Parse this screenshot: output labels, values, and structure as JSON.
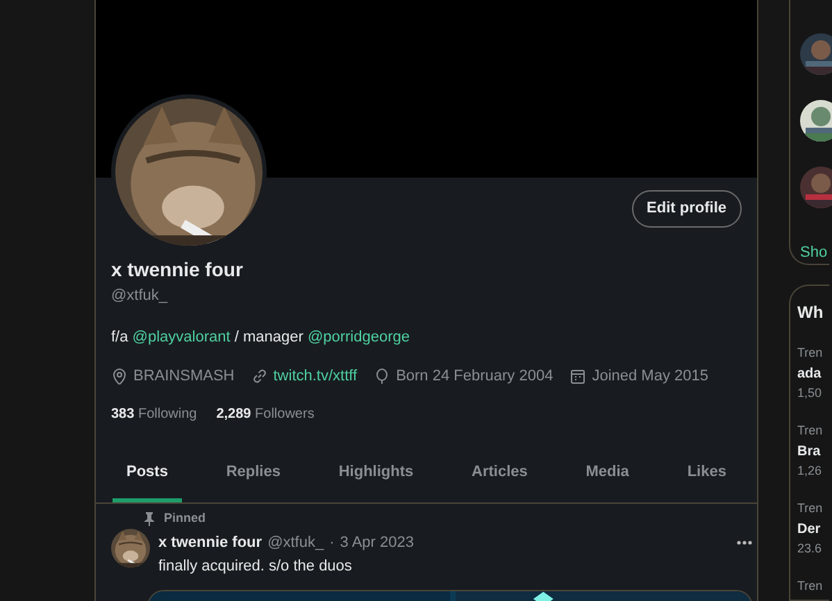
{
  "profile": {
    "edit_button": "Edit profile",
    "name": "x twennie four",
    "handle": "@xtfuk_",
    "bio": [
      {
        "kind": "text",
        "text": "f/a"
      },
      {
        "kind": "link",
        "text": "@playvalorant"
      },
      {
        "kind": "text",
        "text": "/ manager"
      },
      {
        "kind": "link",
        "text": "@porridgeorge"
      }
    ],
    "meta": [
      {
        "kind": "location",
        "text": "BRAINSMASH"
      },
      {
        "kind": "link",
        "text": "twitch.tv/xttff"
      },
      {
        "kind": "birthday",
        "text": "Born 24 February 2004"
      },
      {
        "kind": "joined",
        "text": "Joined May 2015"
      }
    ],
    "stats": [
      {
        "count": "383",
        "label": "Following"
      },
      {
        "count": "2,289",
        "label": "Followers"
      }
    ]
  },
  "tabs": [
    {
      "label": "Posts",
      "selected": true
    },
    {
      "label": "Replies",
      "selected": false
    },
    {
      "label": "Highlights",
      "selected": false
    },
    {
      "label": "Articles",
      "selected": false
    },
    {
      "label": "Media",
      "selected": false
    },
    {
      "label": "Likes",
      "selected": false
    }
  ],
  "pinned_post": {
    "pinned_label": "Pinned",
    "author": "x twennie four",
    "handle": "@xtfuk_",
    "separator": "·",
    "date": "3 Apr 2023",
    "text": "finally acquired. s/o the duos"
  },
  "sidebar": {
    "follow_card": {
      "show_more": "Sho"
    },
    "trends_card": {
      "title": "Wh",
      "items": [
        {
          "context": "Tren",
          "name": "ada",
          "count": "1,50"
        },
        {
          "context": "Tren",
          "name": "Bra",
          "count": "1,26"
        },
        {
          "context": "Tren",
          "name": "Der",
          "count": "23.6"
        },
        {
          "context": "Tren"
        }
      ]
    }
  }
}
